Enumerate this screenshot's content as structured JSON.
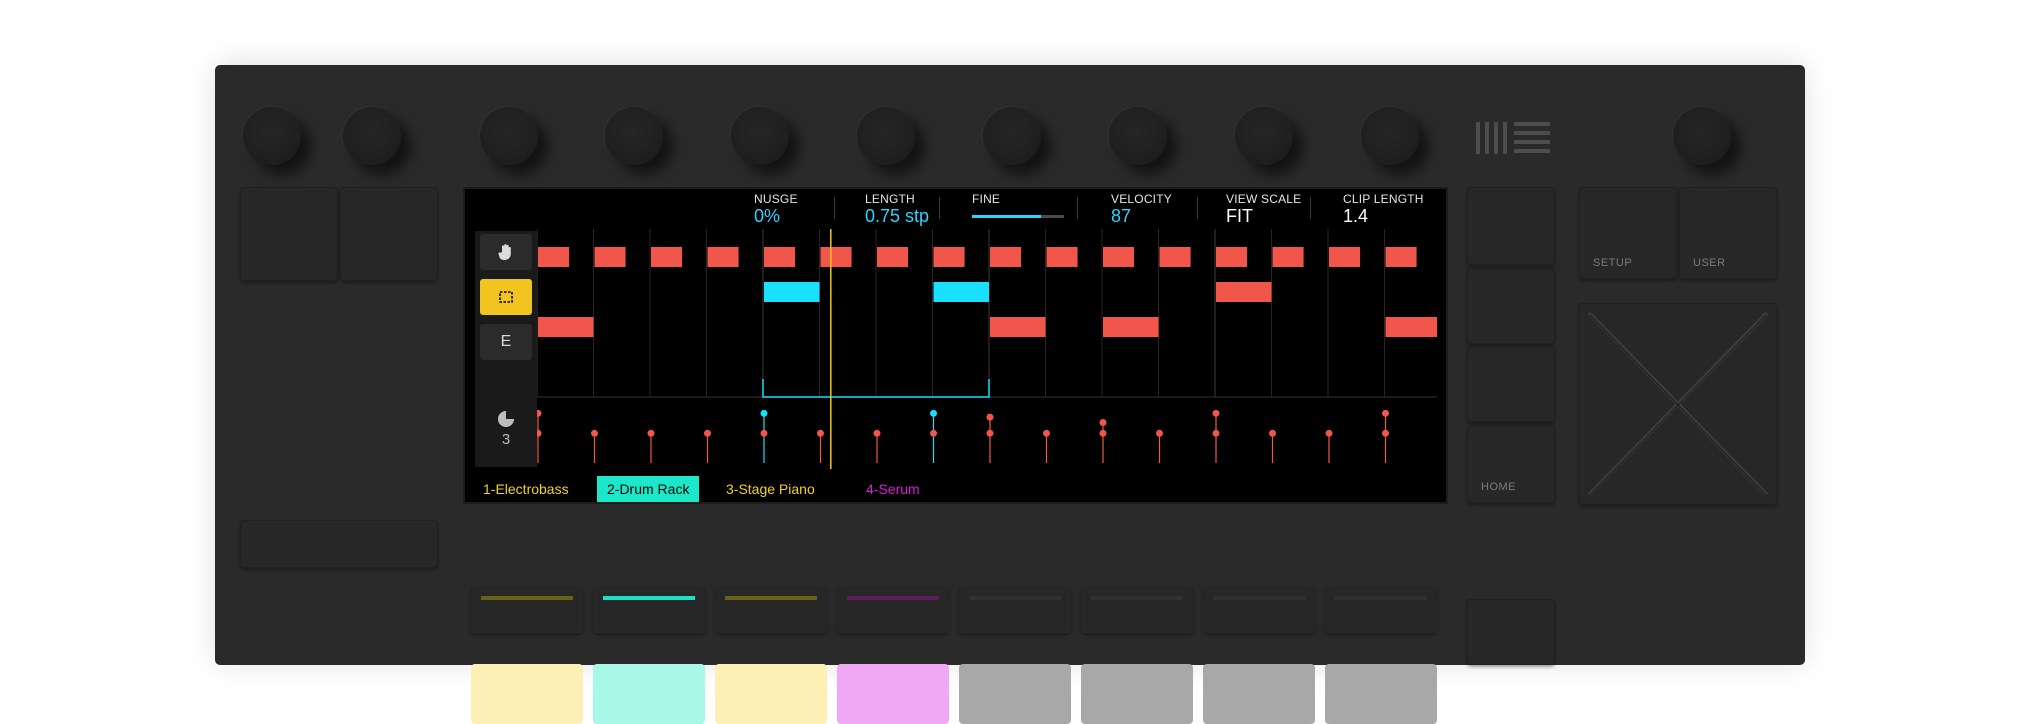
{
  "device": {
    "logo_icon": "ableton-logo-icon",
    "buttons": {
      "setup_label": "SETUP",
      "user_label": "USER",
      "home_label": "HOME"
    }
  },
  "screen": {
    "params": [
      {
        "label": "NUSGE",
        "value": "0%",
        "color": "#2ad4ff"
      },
      {
        "label": "LENGTH",
        "value": "0.75 stp",
        "color": "#2ad4ff"
      },
      {
        "label": "FINE",
        "value": "",
        "color": "#2ad4ff",
        "slider_fraction": 0.75
      },
      {
        "label": "VELOCITY",
        "value": "87",
        "color": "#2ad4ff"
      },
      {
        "label": "VIEW SCALE",
        "value": "FIT",
        "color": "#ffffff"
      },
      {
        "label": "CLIP LENGTH",
        "value": "1.4",
        "color": "#ffffff"
      }
    ],
    "tools": [
      {
        "name": "hand-tool",
        "icon": "hand-icon",
        "label": "",
        "active": false
      },
      {
        "name": "select-tool",
        "icon": "selection-rect-icon",
        "label": "",
        "active": true
      },
      {
        "name": "erase-tool",
        "icon": "",
        "label": "E",
        "active": false
      }
    ],
    "grid_icon": "pie-grid-icon",
    "grid_value": "3",
    "tracks": [
      {
        "label": "1-Electrobass",
        "color": "#f2d21a",
        "selected": false
      },
      {
        "label": "2-Drum Rack",
        "color": "#1be8c8",
        "selected": true
      },
      {
        "label": "3-Stage Piano",
        "color": "#f2d21a",
        "selected": false
      },
      {
        "label": "4-Serum",
        "color": "#d81ed8",
        "selected": false
      }
    ],
    "colors": {
      "note": "#f0574a",
      "selected_note": "#1ae0ff",
      "playhead": "#f2c41f",
      "velocity": "#f0574a"
    },
    "note_grid": {
      "steps": 16,
      "rows": [
        {
          "row": 0,
          "notes": [
            {
              "step": 0,
              "len": 0.55,
              "sel": false
            },
            {
              "step": 1,
              "len": 0.55,
              "sel": false
            },
            {
              "step": 2,
              "len": 0.55,
              "sel": false
            },
            {
              "step": 3,
              "len": 0.55,
              "sel": false
            },
            {
              "step": 4,
              "len": 0.55,
              "sel": false
            },
            {
              "step": 5,
              "len": 0.55,
              "sel": false
            },
            {
              "step": 6,
              "len": 0.55,
              "sel": false
            },
            {
              "step": 7,
              "len": 0.55,
              "sel": false
            },
            {
              "step": 8,
              "len": 0.55,
              "sel": false
            },
            {
              "step": 9,
              "len": 0.55,
              "sel": false
            },
            {
              "step": 10,
              "len": 0.55,
              "sel": false
            },
            {
              "step": 11,
              "len": 0.55,
              "sel": false
            },
            {
              "step": 12,
              "len": 0.55,
              "sel": false
            },
            {
              "step": 13,
              "len": 0.55,
              "sel": false
            },
            {
              "step": 14,
              "len": 0.55,
              "sel": false
            },
            {
              "step": 15,
              "len": 0.55,
              "sel": false
            }
          ]
        },
        {
          "row": 1,
          "notes": [
            {
              "step": 4,
              "len": 1.0,
              "sel": true
            },
            {
              "step": 7,
              "len": 1.0,
              "sel": true
            },
            {
              "step": 12,
              "len": 1.0,
              "sel": false
            }
          ]
        },
        {
          "row": 2,
          "notes": [
            {
              "step": 0,
              "len": 1.0,
              "sel": false
            },
            {
              "step": 8,
              "len": 1.0,
              "sel": false
            },
            {
              "step": 10,
              "len": 1.0,
              "sel": false
            },
            {
              "step": 15,
              "len": 1.0,
              "sel": false
            }
          ]
        }
      ],
      "playhead_step": 5.2,
      "loop_start_step": 4,
      "loop_end_step": 8,
      "velocity_lanes": [
        {
          "step": 0,
          "values": [
            0.92,
            0.55
          ],
          "sel": false
        },
        {
          "step": 1,
          "values": [
            0.55
          ],
          "sel": false
        },
        {
          "step": 2,
          "values": [
            0.55
          ],
          "sel": false
        },
        {
          "step": 3,
          "values": [
            0.55
          ],
          "sel": false
        },
        {
          "step": 4,
          "values": [
            0.92,
            0.55
          ],
          "sel": true
        },
        {
          "step": 5,
          "values": [
            0.55
          ],
          "sel": false
        },
        {
          "step": 6,
          "values": [
            0.55
          ],
          "sel": false
        },
        {
          "step": 7,
          "values": [
            0.92,
            0.55
          ],
          "sel": true
        },
        {
          "step": 8,
          "values": [
            0.85,
            0.55
          ],
          "sel": false
        },
        {
          "step": 9,
          "values": [
            0.55
          ],
          "sel": false
        },
        {
          "step": 10,
          "values": [
            0.75,
            0.55
          ],
          "sel": false
        },
        {
          "step": 11,
          "values": [
            0.55
          ],
          "sel": false
        },
        {
          "step": 12,
          "values": [
            0.92,
            0.55
          ],
          "sel": false
        },
        {
          "step": 13,
          "values": [
            0.55
          ],
          "sel": false
        },
        {
          "step": 14,
          "values": [
            0.55
          ],
          "sel": false
        },
        {
          "step": 15,
          "values": [
            0.92,
            0.55
          ],
          "sel": false
        }
      ]
    }
  },
  "strip_bars": [
    {
      "color": "#6b6218"
    },
    {
      "color": "#1be0c8"
    },
    {
      "color": "#6b6218"
    },
    {
      "color": "#5c1c5c"
    },
    {
      "color": "#303030"
    },
    {
      "color": "#303030"
    },
    {
      "color": "#303030"
    },
    {
      "color": "#303030"
    }
  ],
  "pads": [
    {
      "color": "#fcf0b4"
    },
    {
      "color": "#a8f8e8"
    },
    {
      "color": "#fcf0b4"
    },
    {
      "color": "#f0a8f4"
    },
    {
      "color": "#a8a8a8"
    },
    {
      "color": "#a8a8a8"
    },
    {
      "color": "#a8a8a8"
    },
    {
      "color": "#a8a8a8"
    }
  ]
}
